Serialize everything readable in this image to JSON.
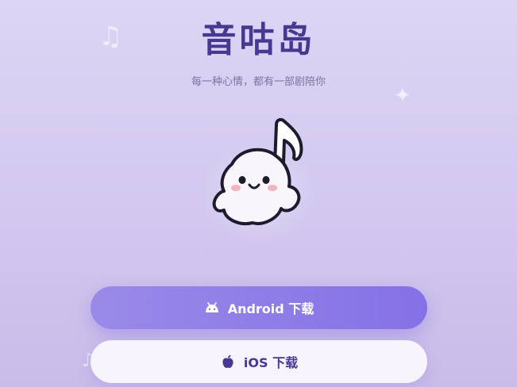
{
  "app": {
    "title": "音咕岛",
    "subtitle": "每一种心情，都有一部剧陪你"
  },
  "decorations": {
    "note_glyph": "♫",
    "small_note_glyph": "♪",
    "sparkle_glyph": "✦",
    "icons": [
      "music-note-icon",
      "sparkle-icon",
      "mascot-icon"
    ]
  },
  "buttons": {
    "android": {
      "label": "Android 下载",
      "icon": "android-icon",
      "color": "#8a77e7"
    },
    "ios": {
      "label": "iOS 下载",
      "icon": "apple-icon",
      "color": "#4a3791"
    }
  },
  "colors": {
    "background": "#d6ccf1",
    "title": "#4a3791",
    "subtitle": "#7b72a3"
  }
}
